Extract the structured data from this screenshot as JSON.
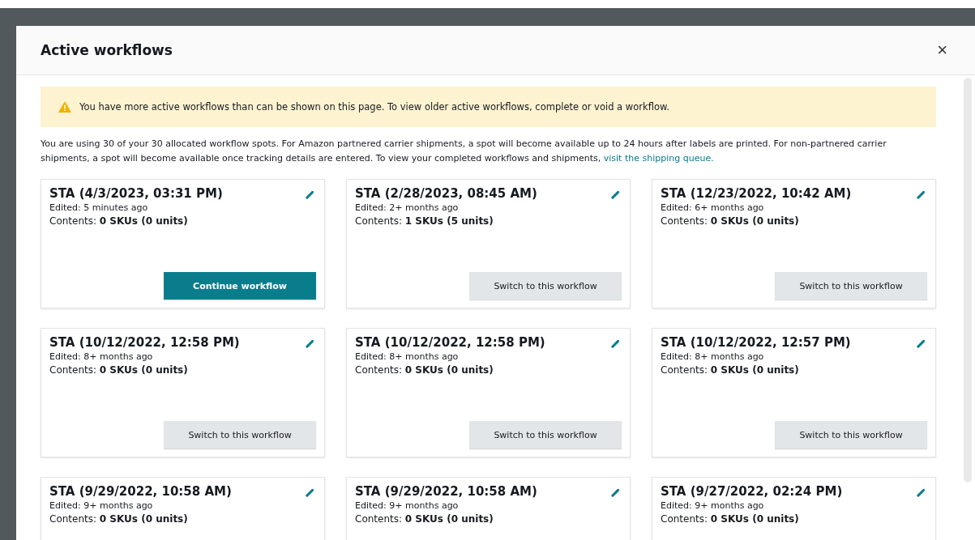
{
  "dialog": {
    "title": "Active workflows",
    "close": "×"
  },
  "alert": {
    "kind": "warning",
    "text": "You have more active workflows than can be shown on this page. To view older active workflows, complete or void a workflow."
  },
  "info": {
    "text": "You are using 30 of your 30 allocated workflow spots. For Amazon partnered carrier shipments, a spot will become available up to 24 hours after labels are printed. For non-partnered carrier shipments, a spot will become available once tracking details are entered. To view your completed workflows and shipments,",
    "link": "visit the shipping queue."
  },
  "workflows": [
    {
      "title": "STA (4/3/2023, 03:31 PM)",
      "edited": "Edited: 5 minutes ago",
      "contents": "Contents: **0 SKUs (0 units)**",
      "button": {
        "kind": "primary",
        "label": "Continue workflow"
      }
    },
    {
      "title": "STA (2/28/2023, 08:45 AM)",
      "edited": "Edited: 2+ months ago",
      "contents": "Contents: **1 SKUs (5 units)**",
      "button": {
        "kind": "secondary",
        "label": "Switch to this workflow"
      }
    },
    {
      "title": "STA (12/23/2022, 10:42 AM)",
      "edited": "Edited: 6+ months ago",
      "contents": "Contents: **0 SKUs (0 units)**",
      "button": {
        "kind": "secondary",
        "label": "Switch to this workflow"
      }
    },
    {
      "title": "STA (10/12/2022, 12:58 PM)",
      "edited": "Edited: 8+ months ago",
      "contents": "Contents: **0 SKUs (0 units)**",
      "button": {
        "kind": "secondary",
        "label": "Switch to this workflow"
      }
    },
    {
      "title": "STA (10/12/2022, 12:58 PM)",
      "edited": "Edited: 8+ months ago",
      "contents": "Contents: **0 SKUs (0 units)**",
      "button": {
        "kind": "secondary",
        "label": "Switch to this workflow"
      }
    },
    {
      "title": "STA (10/12/2022, 12:57 PM)",
      "edited": "Edited: 8+ months ago",
      "contents": "Contents: **0 SKUs (0 units)**",
      "button": {
        "kind": "secondary",
        "label": "Switch to this workflow"
      }
    },
    {
      "title": "STA (9/29/2022, 10:58 AM)",
      "edited": "Edited: 9+ months ago",
      "contents": "Contents: **0 SKUs (0 units)**"
    },
    {
      "title": "STA (9/29/2022, 10:58 AM)",
      "edited": "Edited: 9+ months ago",
      "contents": "Contents: **0 SKUs (0 units)**"
    },
    {
      "title": "STA (9/27/2022, 02:24 PM)",
      "edited": "Edited: 9+ months ago",
      "contents": "Contents: **0 SKUs (0 units)**"
    }
  ]
}
